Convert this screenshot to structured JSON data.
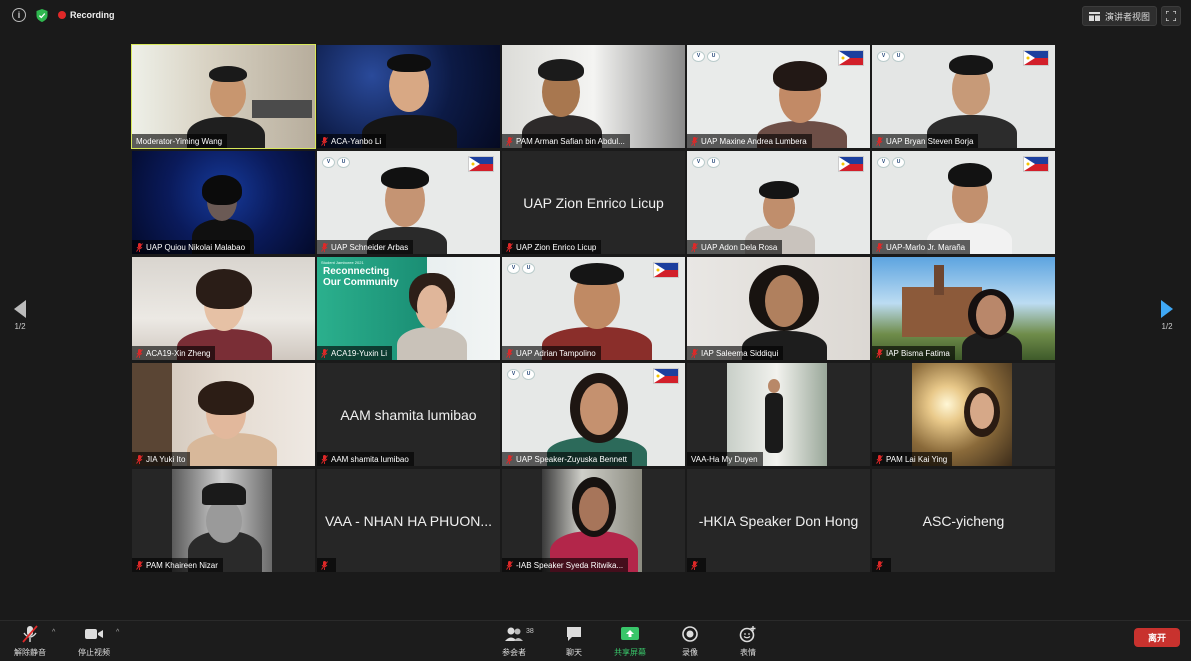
{
  "topbar": {
    "recording": "Recording",
    "speaker_view": "演讲者视图"
  },
  "pager": {
    "left": "1/2",
    "right": "1/2"
  },
  "tiles": [
    {
      "name": "Moderator-Yiming Wang"
    },
    {
      "name": "ACA-Yanbo Li"
    },
    {
      "name": "PAM Arman Safian bin Abdul..."
    },
    {
      "name": "UAP Maxine Andrea Lumbera"
    },
    {
      "name": "UAP Bryan Steven Borja"
    },
    {
      "name": "UAP Quiou Nikolai Malabao"
    },
    {
      "name": "UAP Schneider Arbas"
    },
    {
      "name": "UAP Zion Enrico Licup",
      "big": "UAP Zion Enrico Licup"
    },
    {
      "name": "UAP Adon Dela Rosa"
    },
    {
      "name": "UAP-Marlo Jr. Maraña"
    },
    {
      "name": "ACA19-Xin Zheng"
    },
    {
      "name": "ACA19-Yuxin Li",
      "poster_title": "Reconnecting Our Community",
      "poster_small": "Student Jamboree 2021"
    },
    {
      "name": "UAP Adrian Tampolino"
    },
    {
      "name": "IAP Saleema Siddiqui"
    },
    {
      "name": "IAP Bisma Fatima"
    },
    {
      "name": "JIA Yuki Ito"
    },
    {
      "name": "AAM shamita lumibao",
      "big": "AAM shamita lumibao"
    },
    {
      "name": "UAP Speaker-Zuyuska Bennett"
    },
    {
      "name": "VAA-Ha My Duyen"
    },
    {
      "name": "PAM Lai Kai Ying"
    },
    {
      "name": "PAM Khaireen Nizar"
    },
    {
      "name": "",
      "big": "VAA - NHAN HA PHUON..."
    },
    {
      "name": "-IAB Speaker Syeda Ritwika..."
    },
    {
      "name": "",
      "big": "-HKIA Speaker Don Hong"
    },
    {
      "name": "",
      "big": "ASC-yicheng"
    }
  ],
  "bottombar": {
    "unmute": "解除静音",
    "stop_video": "停止视频",
    "participants": "参会者",
    "participants_count": "38",
    "chat": "聊天",
    "share": "共享屏幕",
    "record": "录像",
    "reactions": "表情",
    "leave": "离开"
  },
  "colors": {
    "active_speaker": "#d8e85a",
    "muted_mic": "#e02828",
    "share_green": "#39c66a",
    "leave_red": "#c8322e",
    "pager_arrow": "#3fa8f5"
  }
}
